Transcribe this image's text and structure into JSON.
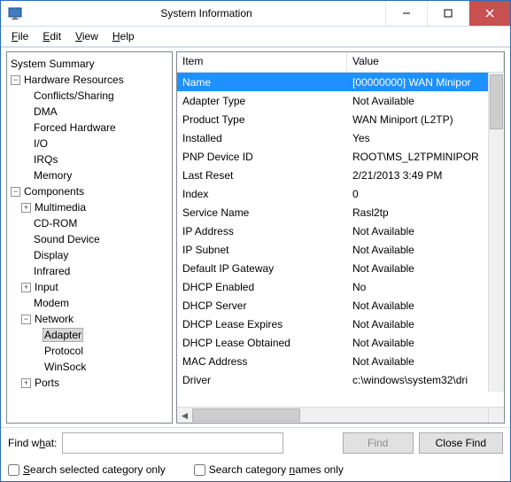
{
  "window": {
    "title": "System Information"
  },
  "menubar": {
    "file": "File",
    "edit": "Edit",
    "view": "View",
    "help": "Help"
  },
  "tree": {
    "summary": "System Summary",
    "hardware": "Hardware Resources",
    "hw_children": {
      "conflicts": "Conflicts/Sharing",
      "dma": "DMA",
      "forced": "Forced Hardware",
      "io": "I/O",
      "irqs": "IRQs",
      "memory": "Memory"
    },
    "components": "Components",
    "comp_children": {
      "multimedia": "Multimedia",
      "cdrom": "CD-ROM",
      "sound": "Sound Device",
      "display": "Display",
      "infrared": "Infrared",
      "input": "Input",
      "modem": "Modem",
      "network": "Network",
      "net_children": {
        "adapter": "Adapter",
        "protocol": "Protocol",
        "winsock": "WinSock"
      },
      "ports": "Ports"
    }
  },
  "grid": {
    "headers": {
      "item": "Item",
      "value": "Value"
    },
    "rows": [
      {
        "item": "Name",
        "value": "[00000000] WAN Minipor",
        "selected": true
      },
      {
        "item": "Adapter Type",
        "value": "Not Available"
      },
      {
        "item": "Product Type",
        "value": "WAN Miniport (L2TP)"
      },
      {
        "item": "Installed",
        "value": "Yes"
      },
      {
        "item": "PNP Device ID",
        "value": "ROOT\\MS_L2TPMINIPOR"
      },
      {
        "item": "Last Reset",
        "value": "2/21/2013 3:49 PM"
      },
      {
        "item": "Index",
        "value": "0"
      },
      {
        "item": "Service Name",
        "value": "Rasl2tp"
      },
      {
        "item": "IP Address",
        "value": "Not Available"
      },
      {
        "item": "IP Subnet",
        "value": "Not Available"
      },
      {
        "item": "Default IP Gateway",
        "value": "Not Available"
      },
      {
        "item": "DHCP Enabled",
        "value": "No"
      },
      {
        "item": "DHCP Server",
        "value": "Not Available"
      },
      {
        "item": "DHCP Lease Expires",
        "value": "Not Available"
      },
      {
        "item": "DHCP Lease Obtained",
        "value": "Not Available"
      },
      {
        "item": "MAC Address",
        "value": "Not Available"
      },
      {
        "item": "Driver",
        "value": "c:\\windows\\system32\\dri"
      }
    ]
  },
  "findbar": {
    "label_pre": "Find w",
    "label_u": "h",
    "label_post": "at:",
    "find_btn": "Find",
    "close_btn_pre": "",
    "close_btn_u": "C",
    "close_btn_post": "lose Find"
  },
  "checks": {
    "c1_u": "S",
    "c1_post": "earch selected category only",
    "c2_pre": "Search category ",
    "c2_u": "n",
    "c2_post": "ames only"
  }
}
